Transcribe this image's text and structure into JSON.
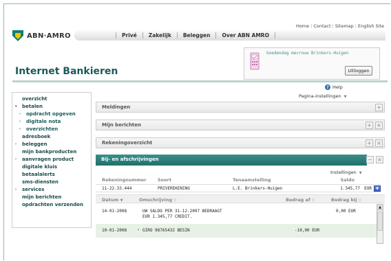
{
  "toplinks": [
    "Home",
    "Contact",
    "Sitemap",
    "English Site"
  ],
  "logo": {
    "text": "ABN·AMRO",
    "colors": {
      "shield_green": "#0b7f77",
      "shield_yellow": "#f3c300"
    }
  },
  "nav": [
    "Privé",
    "Zakelijk",
    "Beleggen",
    "Over ABN AMRO"
  ],
  "greeting": {
    "text": "Goedendag mevrouw Brinkers-Huigen",
    "logout_label": "Uitloggen"
  },
  "title": "Internet Bankieren",
  "help_label": "Help",
  "pagina_label": "Pagina-instellingen",
  "sidebar": [
    {
      "label": "overzicht",
      "sub": false,
      "arrow": ""
    },
    {
      "label": "betalen",
      "sub": false,
      "arrow": "▾"
    },
    {
      "label": "opdracht opgeven",
      "sub": true,
      "arrow": "›"
    },
    {
      "label": "digitale nota",
      "sub": true,
      "arrow": "›"
    },
    {
      "label": "overzichten",
      "sub": true,
      "arrow": "›"
    },
    {
      "label": "adresboek",
      "sub": false,
      "arrow": ""
    },
    {
      "label": "beleggen",
      "sub": false,
      "arrow": "›"
    },
    {
      "label": "mijn bankproducten",
      "sub": false,
      "arrow": ""
    },
    {
      "label": "aanvragen product",
      "sub": false,
      "arrow": "›"
    },
    {
      "label": "digitale kluis",
      "sub": false,
      "arrow": ""
    },
    {
      "label": "betaalalerts",
      "sub": false,
      "arrow": ""
    },
    {
      "label": "sms-diensten",
      "sub": false,
      "arrow": ""
    },
    {
      "label": "services",
      "sub": false,
      "arrow": "›"
    },
    {
      "label": "mijn berichten",
      "sub": false,
      "arrow": ""
    },
    {
      "label": "opdrachten verzenden",
      "sub": false,
      "arrow": ""
    }
  ],
  "panels": {
    "meldingen": "Meldingen",
    "berichten": "Mijn berichten",
    "rekeningoverzicht": "Rekeningoverzicht",
    "bij_af": "Bij- en afschrijvingen"
  },
  "panel_buttons": {
    "expand": "+",
    "close": "×",
    "collapse": "−"
  },
  "instellingen": "Instellingen",
  "account_table": {
    "headers": [
      "Rekeningnummer",
      "Soort",
      "Tenaamstelling",
      "Saldo"
    ],
    "row": {
      "number": "11-22.33.444",
      "soort": "PRIVEREKENING",
      "naam": "L.E. Brinkers-Huigen",
      "saldo": "1.345,77",
      "currency": "EUR"
    }
  },
  "tx_table": {
    "headers": {
      "datum": "Datum",
      "omschrijving": "Omschrijving",
      "af": "Bedrag af",
      "bij": "Bedrag bij"
    },
    "rows": [
      {
        "datum": "14-01-2008",
        "omschrijving_1": "UW SALDO PER 31-12-2007 BEDRAAGT",
        "omschrijving_2": "EUR 1.345,77 CREDIT.",
        "af": "",
        "bij": "0,00 EUR"
      },
      {
        "datum": "10-01-2008",
        "omschrijving_1": "GIRO 98765432 BESIN",
        "omschrijving_2": "",
        "af": "-10,00 EUR",
        "bij": ""
      }
    ]
  }
}
